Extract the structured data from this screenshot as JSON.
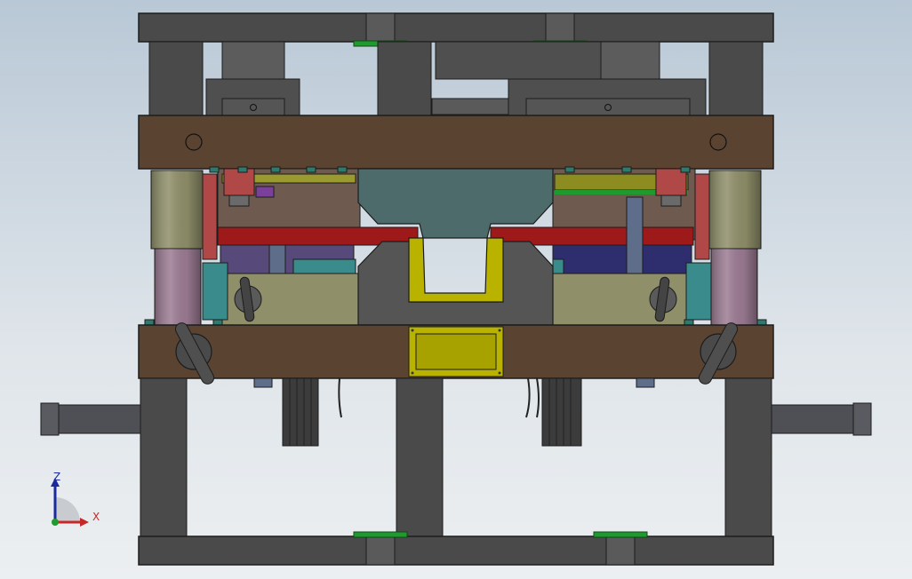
{
  "viewport": {
    "background_top": "#b9c8d6",
    "background_bottom": "#eceff1"
  },
  "colors": {
    "frame": "#4a4a4a",
    "plate_brown": "#5b4331",
    "cavity_teal": "#4e6b6b",
    "part_yellow": "#b9b300",
    "strip_red": "#9e1a1a",
    "plate_navy": "#2e2e6e",
    "pillar_olive": "#8f8f6a",
    "pillar_pink": "#9c7b93",
    "cylinder_cyan": "#3a8c8c",
    "accent_green": "#1f9a2e"
  },
  "model": {
    "parts": [
      "top-clamp-plate",
      "upper-frame",
      "cavity-plate",
      "core-insert",
      "molded-part",
      "hydraulic-cylinder-left",
      "hydraulic-cylinder-right",
      "ejector-plate",
      "bottom-clamp-plate",
      "guide-pillars"
    ]
  },
  "triad": {
    "z_label": "Z",
    "x_label": "X",
    "icon": "axis-triad-icon"
  }
}
